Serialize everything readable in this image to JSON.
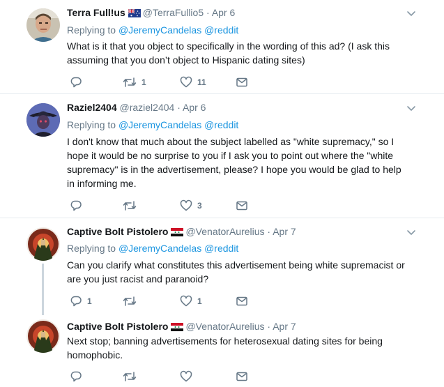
{
  "tweets": [
    {
      "name": "Terra Full!us",
      "handle": "@TerraFullio5",
      "separator": "·",
      "time": "Apr 6",
      "replying_prefix": "Replying to",
      "replying_to": [
        "@JeremyCandelas",
        "@reddit"
      ],
      "text": "What is it that you object to specifically in the wording of this ad? (I ask this assuming that you don’t object to Hispanic dating sites)",
      "reply_count": "",
      "retweet_count": "1",
      "like_count": "11",
      "flag_icon": "australia-flag-icon"
    },
    {
      "name": "Raziel2404",
      "handle": "@raziel2404",
      "separator": "·",
      "time": "Apr 6",
      "replying_prefix": "Replying to",
      "replying_to": [
        "@JeremyCandelas",
        "@reddit"
      ],
      "text": "I don't know that much about the subject labelled as \"white supremacy,\" so I hope it would be no surprise to you if I ask you to point out where the \"white supremacy\" is in the advertisement, please? I hope you would be glad to help in informing me.",
      "reply_count": "",
      "retweet_count": "",
      "like_count": "3"
    },
    {
      "name": "Captive Bolt Pistolero",
      "handle": "@VenatorAurelius",
      "separator": "·",
      "time": "Apr 7",
      "replying_prefix": "Replying to",
      "replying_to": [
        "@JeremyCandelas",
        "@reddit"
      ],
      "text": "Can you clarify what constitutes this advertisement being white supremacist or are you just racist and paranoid?",
      "reply_count": "1",
      "retweet_count": "",
      "like_count": "1",
      "flag_icon": "syria-flag-icon"
    },
    {
      "name": "Captive Bolt Pistolero",
      "handle": "@VenatorAurelius",
      "separator": "·",
      "time": "Apr 7",
      "text": "Next stop; banning advertisements for heterosexual dating sites for being homophobic.",
      "reply_count": "",
      "retweet_count": "",
      "like_count": "",
      "flag_icon": "syria-flag-icon"
    }
  ],
  "colors": {
    "link": "#1b95e0",
    "secondary_text": "#657786",
    "divider": "#e6ecf0",
    "thread_line": "#ccd6dd"
  }
}
